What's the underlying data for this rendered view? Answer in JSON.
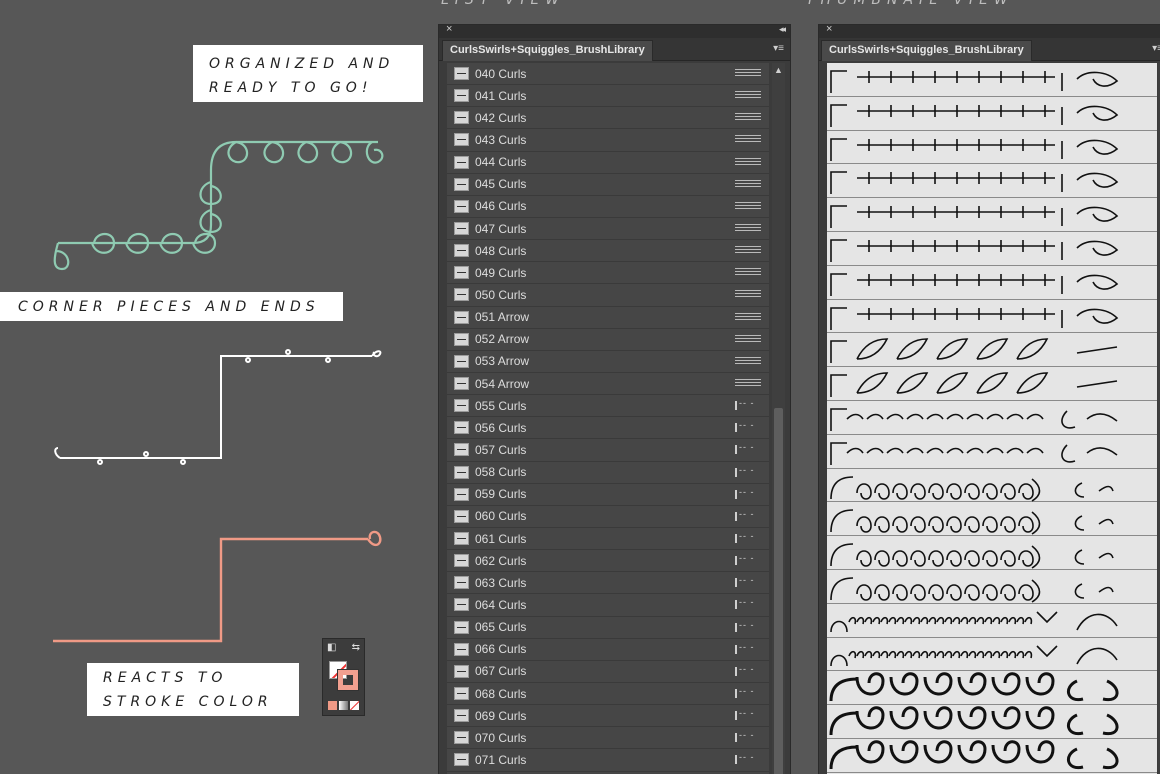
{
  "callouts": {
    "ready_line1": "ORGANIZED AND",
    "ready_line2": "READY TO GO!",
    "corner": "CORNER PIECES AND ENDS",
    "stroke_line1": "REACTS TO",
    "stroke_line2": "STROKE COLOR"
  },
  "captions": {
    "list": "LIST VIEW",
    "thumbnail": "THUMBNAIL VIEW"
  },
  "list_panel": {
    "close": "×",
    "collapse": "◂◂",
    "tab": "CurlsSwirls+Squiggles_BrushLibrary",
    "menu": "▾≡",
    "rows": [
      {
        "label": "040 Curls",
        "type": "pattern"
      },
      {
        "label": "041 Curls",
        "type": "pattern"
      },
      {
        "label": "042 Curls",
        "type": "pattern"
      },
      {
        "label": "043 Curls",
        "type": "pattern"
      },
      {
        "label": "044 Curls",
        "type": "pattern"
      },
      {
        "label": "045 Curls",
        "type": "pattern"
      },
      {
        "label": "046 Curls",
        "type": "pattern"
      },
      {
        "label": "047 Curls",
        "type": "pattern"
      },
      {
        "label": "048 Curls",
        "type": "pattern"
      },
      {
        "label": "049 Curls",
        "type": "pattern"
      },
      {
        "label": "050 Curls",
        "type": "pattern"
      },
      {
        "label": "051 Arrow",
        "type": "pattern"
      },
      {
        "label": "052 Arrow",
        "type": "pattern"
      },
      {
        "label": "053 Arrow",
        "type": "pattern"
      },
      {
        "label": "054 Arrow",
        "type": "pattern"
      },
      {
        "label": "055 Curls",
        "type": "art"
      },
      {
        "label": "056 Curls",
        "type": "art"
      },
      {
        "label": "057 Curls",
        "type": "art"
      },
      {
        "label": "058 Curls",
        "type": "art"
      },
      {
        "label": "059 Curls",
        "type": "art"
      },
      {
        "label": "060 Curls",
        "type": "art"
      },
      {
        "label": "061 Curls",
        "type": "art"
      },
      {
        "label": "062 Curls",
        "type": "art"
      },
      {
        "label": "063 Curls",
        "type": "art"
      },
      {
        "label": "064 Curls",
        "type": "art"
      },
      {
        "label": "065 Curls",
        "type": "art"
      },
      {
        "label": "066 Curls",
        "type": "art"
      },
      {
        "label": "067 Curls",
        "type": "art"
      },
      {
        "label": "068 Curls",
        "type": "art"
      },
      {
        "label": "069 Curls",
        "type": "art"
      },
      {
        "label": "070 Curls",
        "type": "art"
      },
      {
        "label": "071 Curls",
        "type": "art"
      }
    ],
    "scroll_up": "▲"
  },
  "thumb_panel": {
    "close": "×",
    "tab": "CurlsSwirls+Squiggles_BrushLibrary",
    "menu": "▾≡",
    "rows": 21
  },
  "swatch": {
    "default_icon": "◧",
    "swap_icon": "⇆"
  },
  "colors": {
    "curl_green": "#8fcbb2",
    "curl_white": "#ffffff",
    "curl_salmon": "#f09a86",
    "accent_red": "#e33333"
  }
}
